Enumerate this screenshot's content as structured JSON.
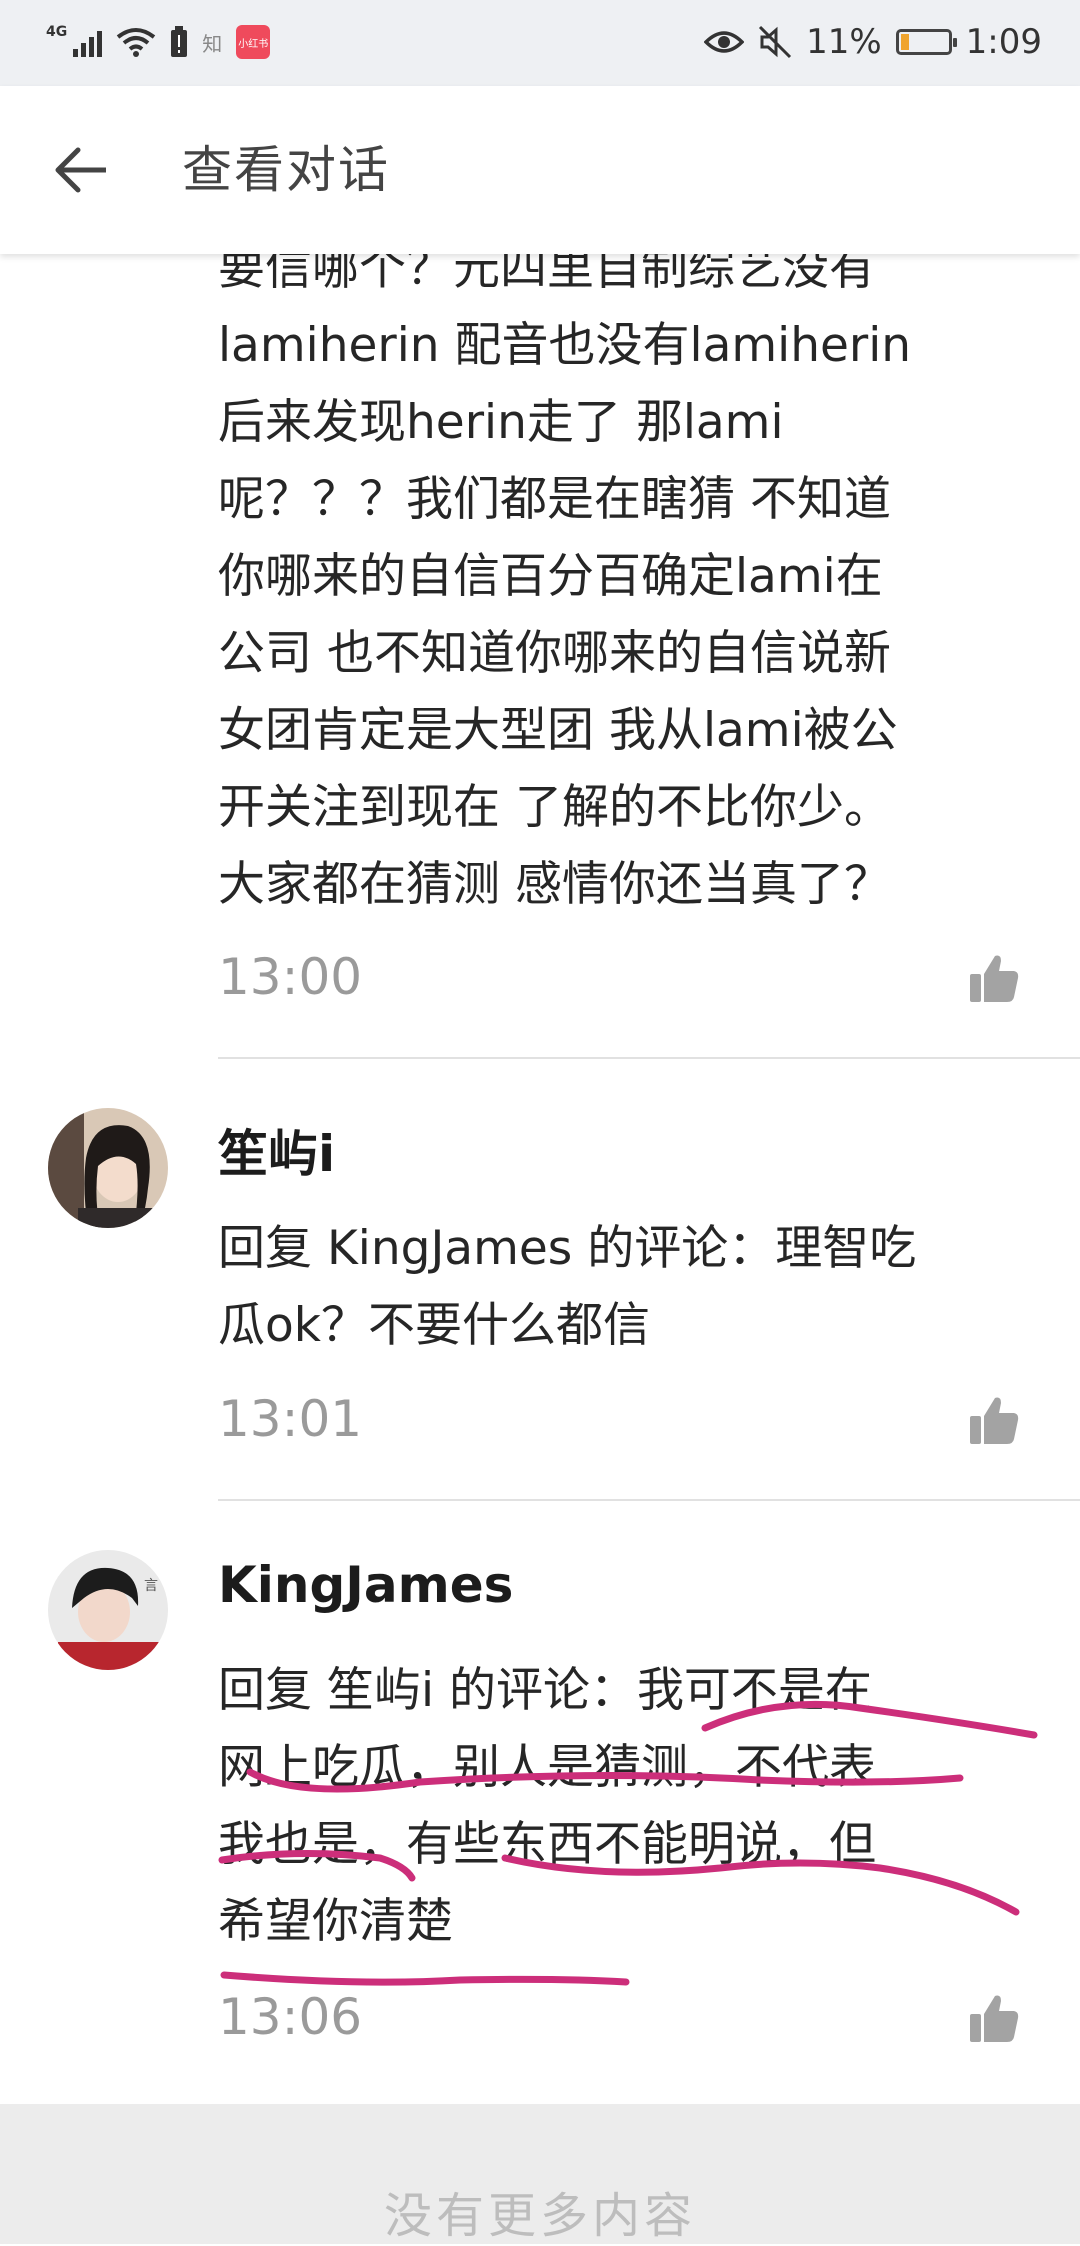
{
  "status_bar": {
    "network": "4G",
    "app_badge": "知",
    "battery": "11%",
    "time": "1:09"
  },
  "header": {
    "title": "查看对话"
  },
  "comments": [
    {
      "text_lines": [
        "要信哪个？元四里自制综艺没有",
        "lamiherin 配音也没有lamiherin",
        "后来发现herin走了 那lami",
        "呢？？？我们都是在瞎猜 不知道",
        "你哪来的自信百分百确定lami在",
        "公司 也不知道你哪来的自信说新",
        "女团肯定是大型团 我从lami被公",
        "开关注到现在 了解的不比你少。",
        "大家都在猜测 感情你还当真了？"
      ],
      "time": "13:00"
    },
    {
      "username": "笙屿i",
      "text_lines": [
        "回复 KingJames 的评论：理智吃",
        "瓜ok？不要什么都信"
      ],
      "time": "13:01"
    },
    {
      "username": "KingJames",
      "text_lines": [
        "回复 笙屿i 的评论：我可不是在",
        "网上吃瓜，别人是猜测，不代表",
        "我也是，有些东西不能明说，但",
        "希望你清楚"
      ],
      "time": "13:06"
    }
  ],
  "footer": {
    "no_more": "没有更多内容"
  },
  "colors": {
    "annotation": "#cc2e7a",
    "battery_level": "#f0a42c"
  }
}
